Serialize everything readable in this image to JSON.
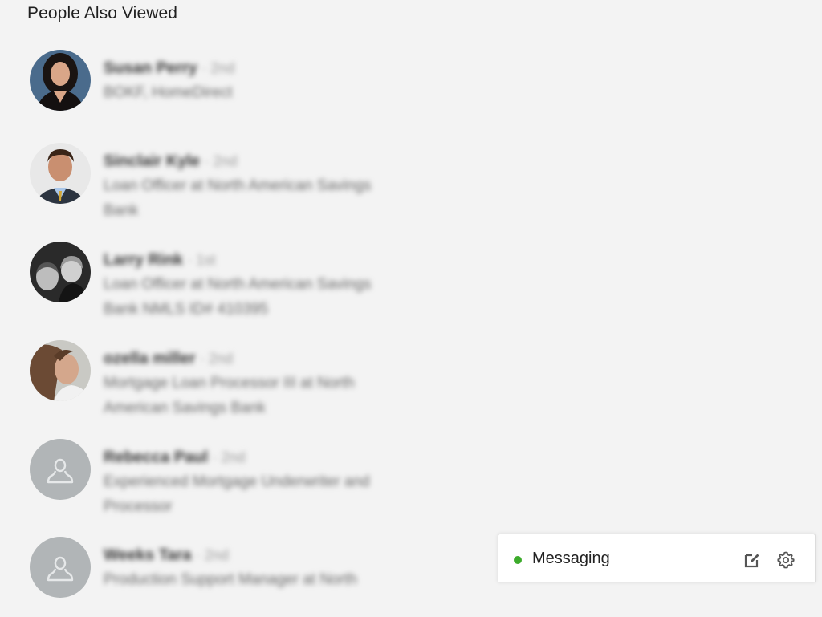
{
  "section": {
    "title": "People Also Viewed"
  },
  "people": [
    {
      "name": "Susan Perry",
      "degree": "· 2nd",
      "headline": "BOKF, HomeDirect",
      "avatar": "photo"
    },
    {
      "name": "Sinclair Kyle",
      "degree": "· 2nd",
      "headline": "Loan Officer at North American Savings Bank",
      "avatar": "photo"
    },
    {
      "name": "Larry Rink",
      "degree": "· 1st",
      "headline": "Loan Officer at North American Savings Bank NMLS ID# 410395",
      "avatar": "photo"
    },
    {
      "name": "ozella miller",
      "degree": "· 2nd",
      "headline": "Mortgage Loan Processor III at North American Savings Bank",
      "avatar": "photo"
    },
    {
      "name": "Rebecca Paul",
      "degree": "· 2nd",
      "headline": "Experienced Mortgage Underwriter and Processor",
      "avatar": "placeholder"
    },
    {
      "name": "Weeks Tara",
      "degree": "· 2nd",
      "headline": "Production Support Manager at North",
      "avatar": "placeholder"
    }
  ],
  "messaging": {
    "label": "Messaging",
    "status": "online",
    "status_color": "#3cab2b",
    "compose_icon": "compose-icon",
    "settings_icon": "gear-icon"
  }
}
